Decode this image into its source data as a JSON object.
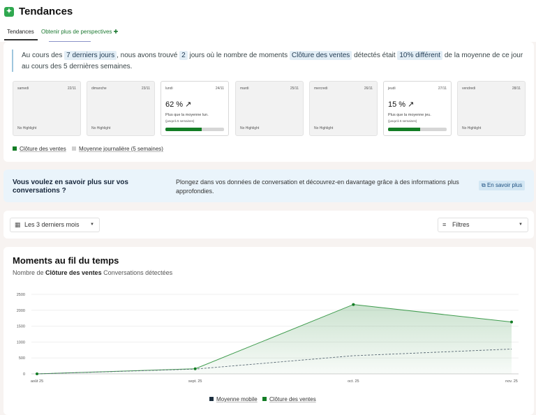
{
  "header": {
    "logo_glyph": "✦",
    "title": "Tendances"
  },
  "tabs": {
    "trends": "Tendances",
    "more": "Obtenir plus de perspectives",
    "more_icon": "✚"
  },
  "summary": {
    "part1": "Au cours des",
    "days_hl": "7 derniers jours",
    "part2": ", nous avons trouvé",
    "count_hl": "2",
    "part3": "jours où le nombre de moments",
    "moment_hl": "Clôture des ventes",
    "part4": "détectés était",
    "diff_hl": "10% différent",
    "part5": "de la moyenne de ce jour au cours des 5 dernières semaines."
  },
  "days": [
    {
      "name": "samedi",
      "date": "22/11",
      "highlight": false,
      "note": "No Highlight"
    },
    {
      "name": "dimanche",
      "date": "23/11",
      "highlight": false,
      "note": "No Highlight"
    },
    {
      "name": "lundi",
      "date": "24/11",
      "highlight": true,
      "pct": "62 %",
      "arrow": "↗",
      "desc": "Plus que la moyenne lun.",
      "sub": "(jusqu'à 5 semaines)",
      "fill": 0.62
    },
    {
      "name": "mardi",
      "date": "25/11",
      "highlight": false,
      "note": "No Highlight"
    },
    {
      "name": "mercredi",
      "date": "26/11",
      "highlight": false,
      "note": "No Highlight"
    },
    {
      "name": "jeudi",
      "date": "27/11",
      "highlight": true,
      "pct": "15 %",
      "arrow": "↗",
      "desc": "Plus que la moyenne jeu.",
      "sub": "(jusqu'à 5 semaines)",
      "fill": 0.55
    },
    {
      "name": "vendredi",
      "date": "28/11",
      "highlight": false,
      "note": "No Highlight"
    }
  ],
  "legend_days": {
    "series": "Clôture des ventes",
    "average": "Moyenne journalière (5 semaines)"
  },
  "promo": {
    "title": "Vous voulez en savoir plus sur vos conversations ?",
    "text": "Plongez dans vos données de conversation et découvrez-en davantage grâce à des informations plus approfondies.",
    "button": "En savoir plus",
    "button_icon": "⧉"
  },
  "filters": {
    "period": "Les 3 derniers mois",
    "period_icon": "▦",
    "filters": "Filtres",
    "filters_icon": "≡",
    "caret": "▼"
  },
  "chart_header": {
    "title": "Moments au fil du temps",
    "sub_prefix": "Nombre de",
    "sub_bold": "Clôture des ventes",
    "sub_suffix": "Conversations détectées"
  },
  "colors": {
    "green": "#137d25",
    "navy": "#1c2f3f",
    "highlight_bg": "#e3eef6"
  },
  "chart_data": {
    "type": "area",
    "categories": [
      "août 25",
      "sept. 25",
      "oct. 25",
      "nov. 25"
    ],
    "yticks": [
      0,
      500,
      1000,
      1500,
      2000,
      2500
    ],
    "ylim": [
      0,
      2500
    ],
    "grid": true,
    "legend_position": "bottom",
    "series": [
      {
        "name": "Moyenne mobile",
        "values": [
          0,
          150,
          570,
          780
        ],
        "style": "dashed",
        "color": "#1c2f3f"
      },
      {
        "name": "Clôture des ventes",
        "values": [
          0,
          160,
          2180,
          1630
        ],
        "style": "area",
        "color": "#137d25"
      }
    ]
  }
}
